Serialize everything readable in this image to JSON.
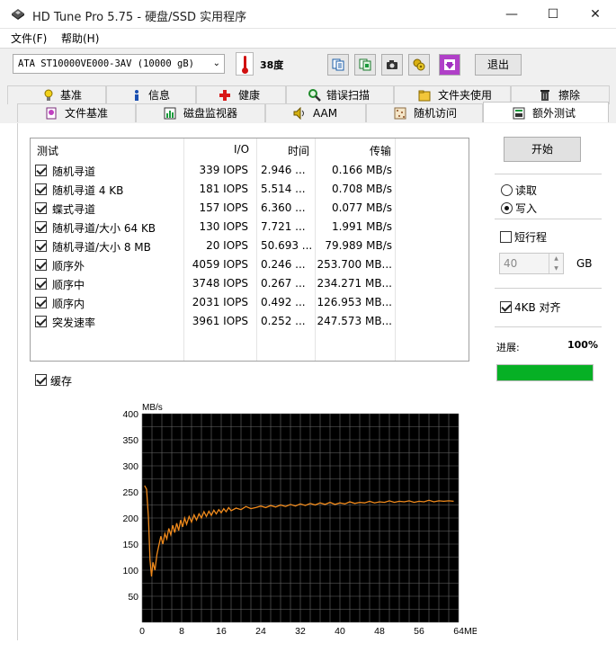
{
  "window": {
    "title": "HD Tune Pro 5.75 - 硬盘/SSD 实用程序",
    "min_glyph": "—",
    "max_glyph": "☐",
    "close_glyph": "✕"
  },
  "menu": {
    "items": [
      {
        "label": "文件(F)"
      },
      {
        "label": "帮助(H)"
      }
    ]
  },
  "toolbar": {
    "drive": "ATA    ST10000VE000-3AV (10000 gB)",
    "temperature": "38度",
    "buttons": [
      "copy-text-icon",
      "copy-info-icon",
      "screenshot-icon",
      "options-icon",
      "save-icon"
    ],
    "exit_label": "退出"
  },
  "tabs": {
    "row1": [
      {
        "label": "基准",
        "icon": "bulb-icon"
      },
      {
        "label": "信息",
        "icon": "info-icon"
      },
      {
        "label": "健康",
        "icon": "health-cross-icon"
      },
      {
        "label": "错误扫描",
        "icon": "magnifier-icon"
      },
      {
        "label": "文件夹使用",
        "icon": "folder-icon"
      },
      {
        "label": "擦除",
        "icon": "trash-icon"
      }
    ],
    "row2": [
      {
        "label": "文件基准",
        "icon": "file-benchmark-icon"
      },
      {
        "label": "磁盘监视器",
        "icon": "disk-monitor-icon"
      },
      {
        "label": "AAM",
        "icon": "speaker-icon"
      },
      {
        "label": "随机访问",
        "icon": "random-access-icon"
      },
      {
        "label": "额外测试",
        "icon": "extra-tests-icon",
        "active": true
      }
    ]
  },
  "results": {
    "headers": {
      "test": "测试",
      "io": "I/O",
      "time": "时间",
      "transfer": "传输"
    },
    "rows": [
      {
        "checked": true,
        "name": "随机寻道",
        "io": "339 IOPS",
        "time": "2.946 ...",
        "transfer": "0.166 MB/s"
      },
      {
        "checked": true,
        "name": "随机寻道 4 KB",
        "io": "181 IOPS",
        "time": "5.514 ...",
        "transfer": "0.708 MB/s"
      },
      {
        "checked": true,
        "name": "蝶式寻道",
        "io": "157 IOPS",
        "time": "6.360 ...",
        "transfer": "0.077 MB/s"
      },
      {
        "checked": true,
        "name": "随机寻道/大小 64 KB",
        "io": "130 IOPS",
        "time": "7.721 ...",
        "transfer": "1.991 MB/s"
      },
      {
        "checked": true,
        "name": "随机寻道/大小 8 MB",
        "io": "20 IOPS",
        "time": "50.693 ...",
        "transfer": "79.989 MB/s"
      },
      {
        "checked": true,
        "name": "顺序外",
        "io": "4059 IOPS",
        "time": "0.246 ...",
        "transfer": "253.700 MB..."
      },
      {
        "checked": true,
        "name": "顺序中",
        "io": "3748 IOPS",
        "time": "0.267 ...",
        "transfer": "234.271 MB..."
      },
      {
        "checked": true,
        "name": "顺序内",
        "io": "2031 IOPS",
        "time": "0.492 ...",
        "transfer": "126.953 MB..."
      },
      {
        "checked": true,
        "name": "突发速率",
        "io": "3961 IOPS",
        "time": "0.252 ...",
        "transfer": "247.573 MB..."
      }
    ]
  },
  "cache": {
    "checked": true,
    "label": "缓存"
  },
  "controls": {
    "start_label": "开始",
    "read_label": "读取",
    "write_label": "写入",
    "mode_selected": "write",
    "short_stroke_label": "短行程",
    "short_stroke_checked": false,
    "size_value": "40",
    "size_unit": "GB",
    "align_label": "4KB 对齐",
    "align_checked": true,
    "progress_label": "进展:",
    "progress_value": "100%",
    "progress_fraction": 1.0,
    "progress_color": "#06b025"
  },
  "chart_data": {
    "type": "line",
    "ylabel": "MB/s",
    "xlabel": "",
    "x_tick_labels": [
      "0",
      "8",
      "16",
      "24",
      "32",
      "40",
      "48",
      "56",
      "64MB"
    ],
    "x_ticks": [
      0,
      8,
      16,
      24,
      32,
      40,
      48,
      56,
      64
    ],
    "y_ticks": [
      50,
      100,
      150,
      200,
      250,
      300,
      350,
      400
    ],
    "xlim": [
      0,
      64
    ],
    "ylim": [
      0,
      400
    ],
    "background": "#000000",
    "grid_color": "#6a6a6a",
    "line_color": "#f08a1c",
    "series": [
      {
        "x": [
          0.5,
          0.9,
          1.3,
          1.6,
          1.9,
          2.2,
          2.6,
          3.0,
          3.4,
          3.8,
          4.2,
          4.6,
          5.0,
          5.4,
          5.8,
          6.2,
          6.6,
          7.0,
          7.4,
          7.8,
          8.2,
          8.6,
          9.0,
          9.5,
          10.0,
          10.5,
          11.0,
          11.5,
          12.0,
          12.5,
          13.0,
          13.5,
          14.0,
          14.5,
          15.0,
          15.5,
          16.0,
          16.5,
          17.0,
          17.5,
          18.0,
          19.0,
          20.0,
          21.0,
          22.0,
          23.0,
          24.0,
          25.0,
          26.0,
          27.0,
          28.0,
          29.0,
          30.0,
          31.0,
          32.0,
          33.0,
          34.0,
          35.0,
          36.0,
          37.0,
          38.0,
          39.0,
          40.0,
          41.0,
          42.0,
          43.0,
          44.0,
          45.0,
          46.0,
          47.0,
          48.0,
          49.0,
          50.0,
          51.0,
          52.0,
          53.0,
          54.0,
          55.0,
          56.0,
          57.0,
          58.0,
          59.0,
          60.0,
          61.0,
          62.0,
          63.0
        ],
        "y": [
          262,
          255,
          200,
          120,
          88,
          115,
          100,
          130,
          148,
          165,
          150,
          170,
          160,
          180,
          168,
          186,
          172,
          190,
          176,
          196,
          183,
          200,
          188,
          203,
          192,
          206,
          196,
          208,
          200,
          212,
          203,
          213,
          205,
          215,
          208,
          216,
          210,
          218,
          212,
          220,
          214,
          219,
          216,
          222,
          218,
          220,
          223,
          220,
          224,
          221,
          225,
          222,
          226,
          223,
          227,
          224,
          228,
          225,
          229,
          226,
          230,
          226,
          229,
          227,
          231,
          228,
          230,
          229,
          232,
          229,
          231,
          230,
          233,
          230,
          232,
          231,
          233,
          230,
          232,
          231,
          234,
          231,
          233,
          232,
          233,
          232
        ]
      }
    ]
  }
}
